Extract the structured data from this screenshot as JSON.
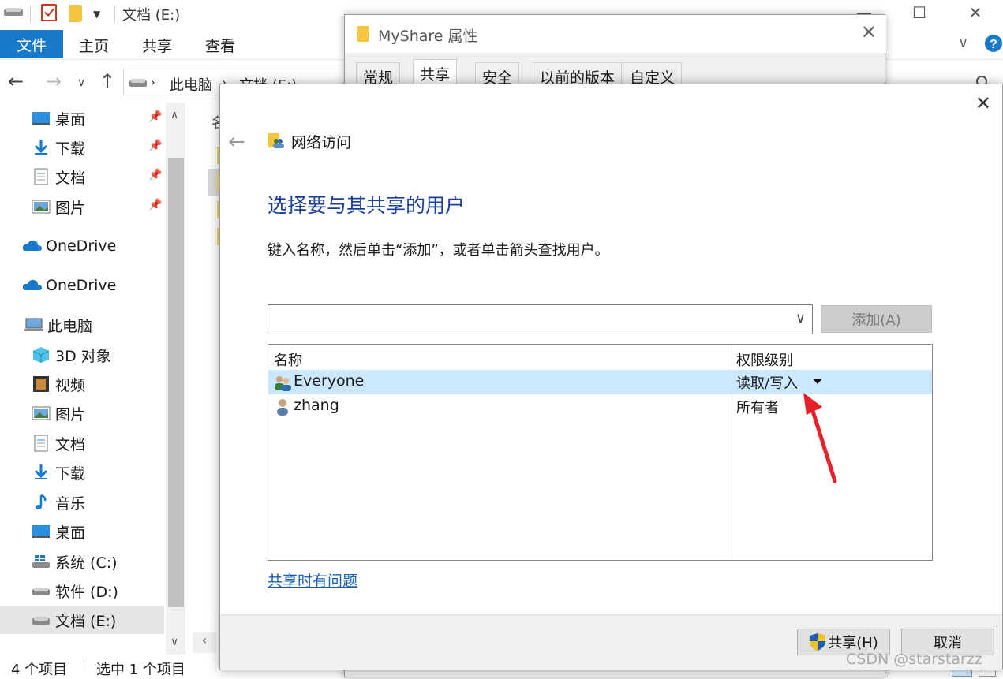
{
  "explorer": {
    "title": "文档 (E:)",
    "ribbon": {
      "file": "文件",
      "tabs": [
        "主页",
        "共享",
        "查看"
      ]
    },
    "address": {
      "crumbs": [
        "此电脑",
        "文档 (E:)"
      ]
    },
    "content_header": "名",
    "nav": [
      {
        "label": "桌面"
      },
      {
        "label": "下载"
      },
      {
        "label": "文档"
      },
      {
        "label": "图片"
      },
      {
        "label": "OneDrive"
      },
      {
        "label": "OneDrive"
      },
      {
        "label": "此电脑"
      },
      {
        "label": "3D 对象"
      },
      {
        "label": "视频"
      },
      {
        "label": "图片"
      },
      {
        "label": "文档"
      },
      {
        "label": "下载"
      },
      {
        "label": "音乐"
      },
      {
        "label": "桌面"
      },
      {
        "label": "系统 (C:)"
      },
      {
        "label": "软件 (D:)"
      },
      {
        "label": "文档 (E:)"
      }
    ],
    "status": {
      "count": "4 个项目",
      "selected": "选中 1 个项目"
    }
  },
  "properties": {
    "title": "MyShare 属性",
    "tabs": [
      "常规",
      "共享",
      "安全",
      "以前的版本",
      "自定义"
    ]
  },
  "dialog": {
    "header": "网络访问",
    "heading": "选择要与其共享的用户",
    "description": "键入名称，然后单击“添加”，或者单击箭头查找用户。",
    "input_value": "",
    "add_button": "添加(A)",
    "columns": {
      "name": "名称",
      "permission": "权限级别"
    },
    "users": [
      {
        "name": "Everyone",
        "permission": "读取/写入"
      },
      {
        "name": "zhang",
        "permission": "所有者"
      }
    ],
    "help_link": "共享时有问题",
    "share_button": "共享(H)",
    "cancel_button": "取消"
  },
  "watermark": "CSDN @starstarzz",
  "colors": {
    "accent": "#1979ca",
    "selected_row": "#cce8ff",
    "heading": "#1a3e9a",
    "link": "#1a5fb4",
    "annotation_arrow": "#e8202a"
  }
}
